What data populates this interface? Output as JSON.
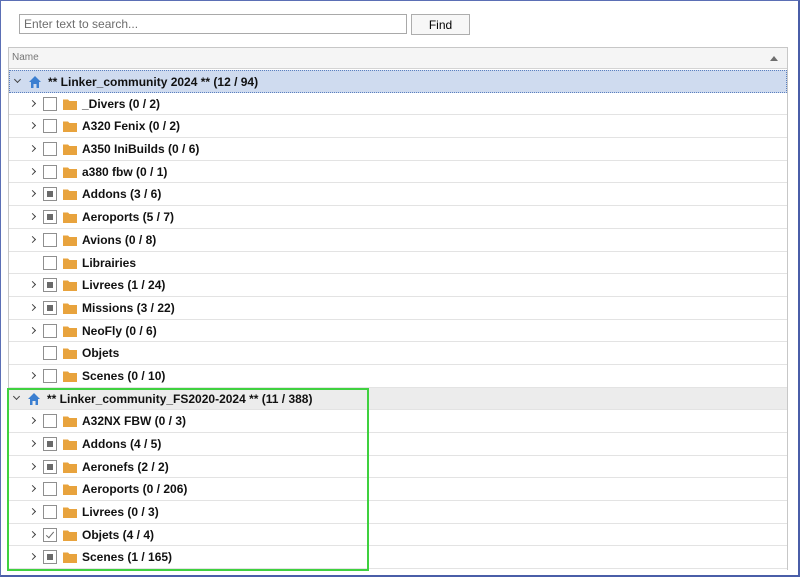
{
  "search": {
    "placeholder": "Enter text to search...",
    "value": ""
  },
  "find_label": "Find",
  "tree": {
    "column_name": "Name",
    "groups": [
      {
        "label": "** Linker_community 2024 ** (12 / 94)",
        "selected": true,
        "items": [
          {
            "label": "_Divers (0 / 2)",
            "check": "none",
            "expandable": true
          },
          {
            "label": "A320 Fenix (0 / 2)",
            "check": "none",
            "expandable": true
          },
          {
            "label": "A350 IniBuilds (0 / 6)",
            "check": "none",
            "expandable": true
          },
          {
            "label": "a380 fbw (0 / 1)",
            "check": "none",
            "expandable": true
          },
          {
            "label": "Addons (3 / 6)",
            "check": "partial",
            "expandable": true
          },
          {
            "label": "Aeroports (5 / 7)",
            "check": "partial",
            "expandable": true
          },
          {
            "label": "Avions (0 / 8)",
            "check": "none",
            "expandable": true
          },
          {
            "label": "Librairies",
            "check": "none",
            "expandable": false
          },
          {
            "label": "Livrees (1 / 24)",
            "check": "partial",
            "expandable": true
          },
          {
            "label": "Missions (3 / 22)",
            "check": "partial",
            "expandable": true
          },
          {
            "label": "NeoFly (0 / 6)",
            "check": "none",
            "expandable": true
          },
          {
            "label": "Objets",
            "check": "none",
            "expandable": false
          },
          {
            "label": "Scenes (0 / 10)",
            "check": "none",
            "expandable": true
          }
        ]
      },
      {
        "label": "** Linker_community_FS2020-2024 ** (11 / 388)",
        "selected": false,
        "items": [
          {
            "label": "A32NX FBW (0 / 3)",
            "check": "none",
            "expandable": true
          },
          {
            "label": "Addons (4 / 5)",
            "check": "partial",
            "expandable": true
          },
          {
            "label": "Aeronefs (2 / 2)",
            "check": "partial",
            "expandable": true
          },
          {
            "label": "Aeroports (0 / 206)",
            "check": "none",
            "expandable": true
          },
          {
            "label": "Livrees (0 / 3)",
            "check": "none",
            "expandable": true
          },
          {
            "label": "Objets (4 / 4)",
            "check": "checked",
            "expandable": true
          },
          {
            "label": "Scenes (1 / 165)",
            "check": "partial",
            "expandable": true
          }
        ]
      }
    ]
  },
  "colors": {
    "folder": "#e8a33d",
    "home": "#3b7fd1",
    "highlight": "#3fd13f",
    "selected_row": "#c9d8ee"
  }
}
